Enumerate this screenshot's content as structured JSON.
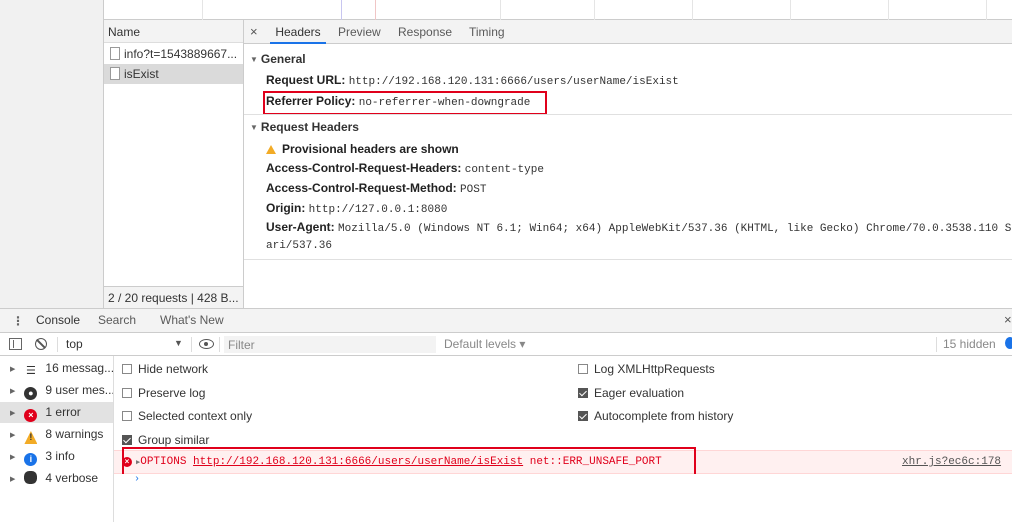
{
  "network": {
    "name_header": "Name",
    "requests": [
      {
        "name": "info?t=1543889667..."
      },
      {
        "name": "isExist"
      }
    ],
    "footer": "2 / 20 requests | 428 B..."
  },
  "details": {
    "close_glyph": "×",
    "tabs": [
      "Headers",
      "Preview",
      "Response",
      "Timing"
    ],
    "general": {
      "title": "General",
      "request_url_key": "Request URL:",
      "request_url_value": "http://192.168.120.131:6666/users/userName/isExist",
      "referrer_key": "Referrer Policy:",
      "referrer_value": "no-referrer-when-downgrade"
    },
    "request_headers": {
      "title": "Request Headers",
      "provisional": "Provisional headers are shown",
      "acrh_key": "Access-Control-Request-Headers:",
      "acrh_value": "content-type",
      "acrm_key": "Access-Control-Request-Method:",
      "acrm_value": "POST",
      "origin_key": "Origin:",
      "origin_value": "http://127.0.0.1:8080",
      "ua_key": "User-Agent:",
      "ua_value": "Mozilla/5.0 (Windows NT 6.1; Win64; x64) AppleWebKit/537.36 (KHTML, like Gecko) Chrome/70.0.3538.110 S",
      "ua_value_cont": "ari/537.36"
    }
  },
  "drawer": {
    "tabs": [
      "Console",
      "Search",
      "What's New"
    ],
    "close_glyph": "×"
  },
  "console_toolbar": {
    "context": "top",
    "filter_placeholder": "Filter",
    "levels": "Default levels ▾",
    "hidden": "15 hidden"
  },
  "sidebar": {
    "items": [
      {
        "label": "16 messag...",
        "icon": "list-icon"
      },
      {
        "label": "9 user mes...",
        "icon": "user-icon"
      },
      {
        "label": "1 error",
        "icon": "error-icon"
      },
      {
        "label": "8 warnings",
        "icon": "warning-icon"
      },
      {
        "label": "3 info",
        "icon": "info-icon"
      },
      {
        "label": "4 verbose",
        "icon": "bug-icon"
      }
    ]
  },
  "settings": {
    "hide_network": "Hide network",
    "preserve_log": "Preserve log",
    "selected_context": "Selected context only",
    "group_similar": "Group similar",
    "log_xhr": "Log XMLHttpRequests",
    "eager_eval": "Eager evaluation",
    "autocomplete": "Autocomplete from history"
  },
  "error": {
    "method": "OPTIONS",
    "url": "http://192.168.120.131:6666/users/userName/isExist",
    "code": "net::ERR_UNSAFE_PORT",
    "source": "xhr.js?ec6c:178"
  },
  "colors": {
    "highlight_box": "#e0001b",
    "active_tab": "#1a73e8",
    "error_text": "#e0001b"
  }
}
